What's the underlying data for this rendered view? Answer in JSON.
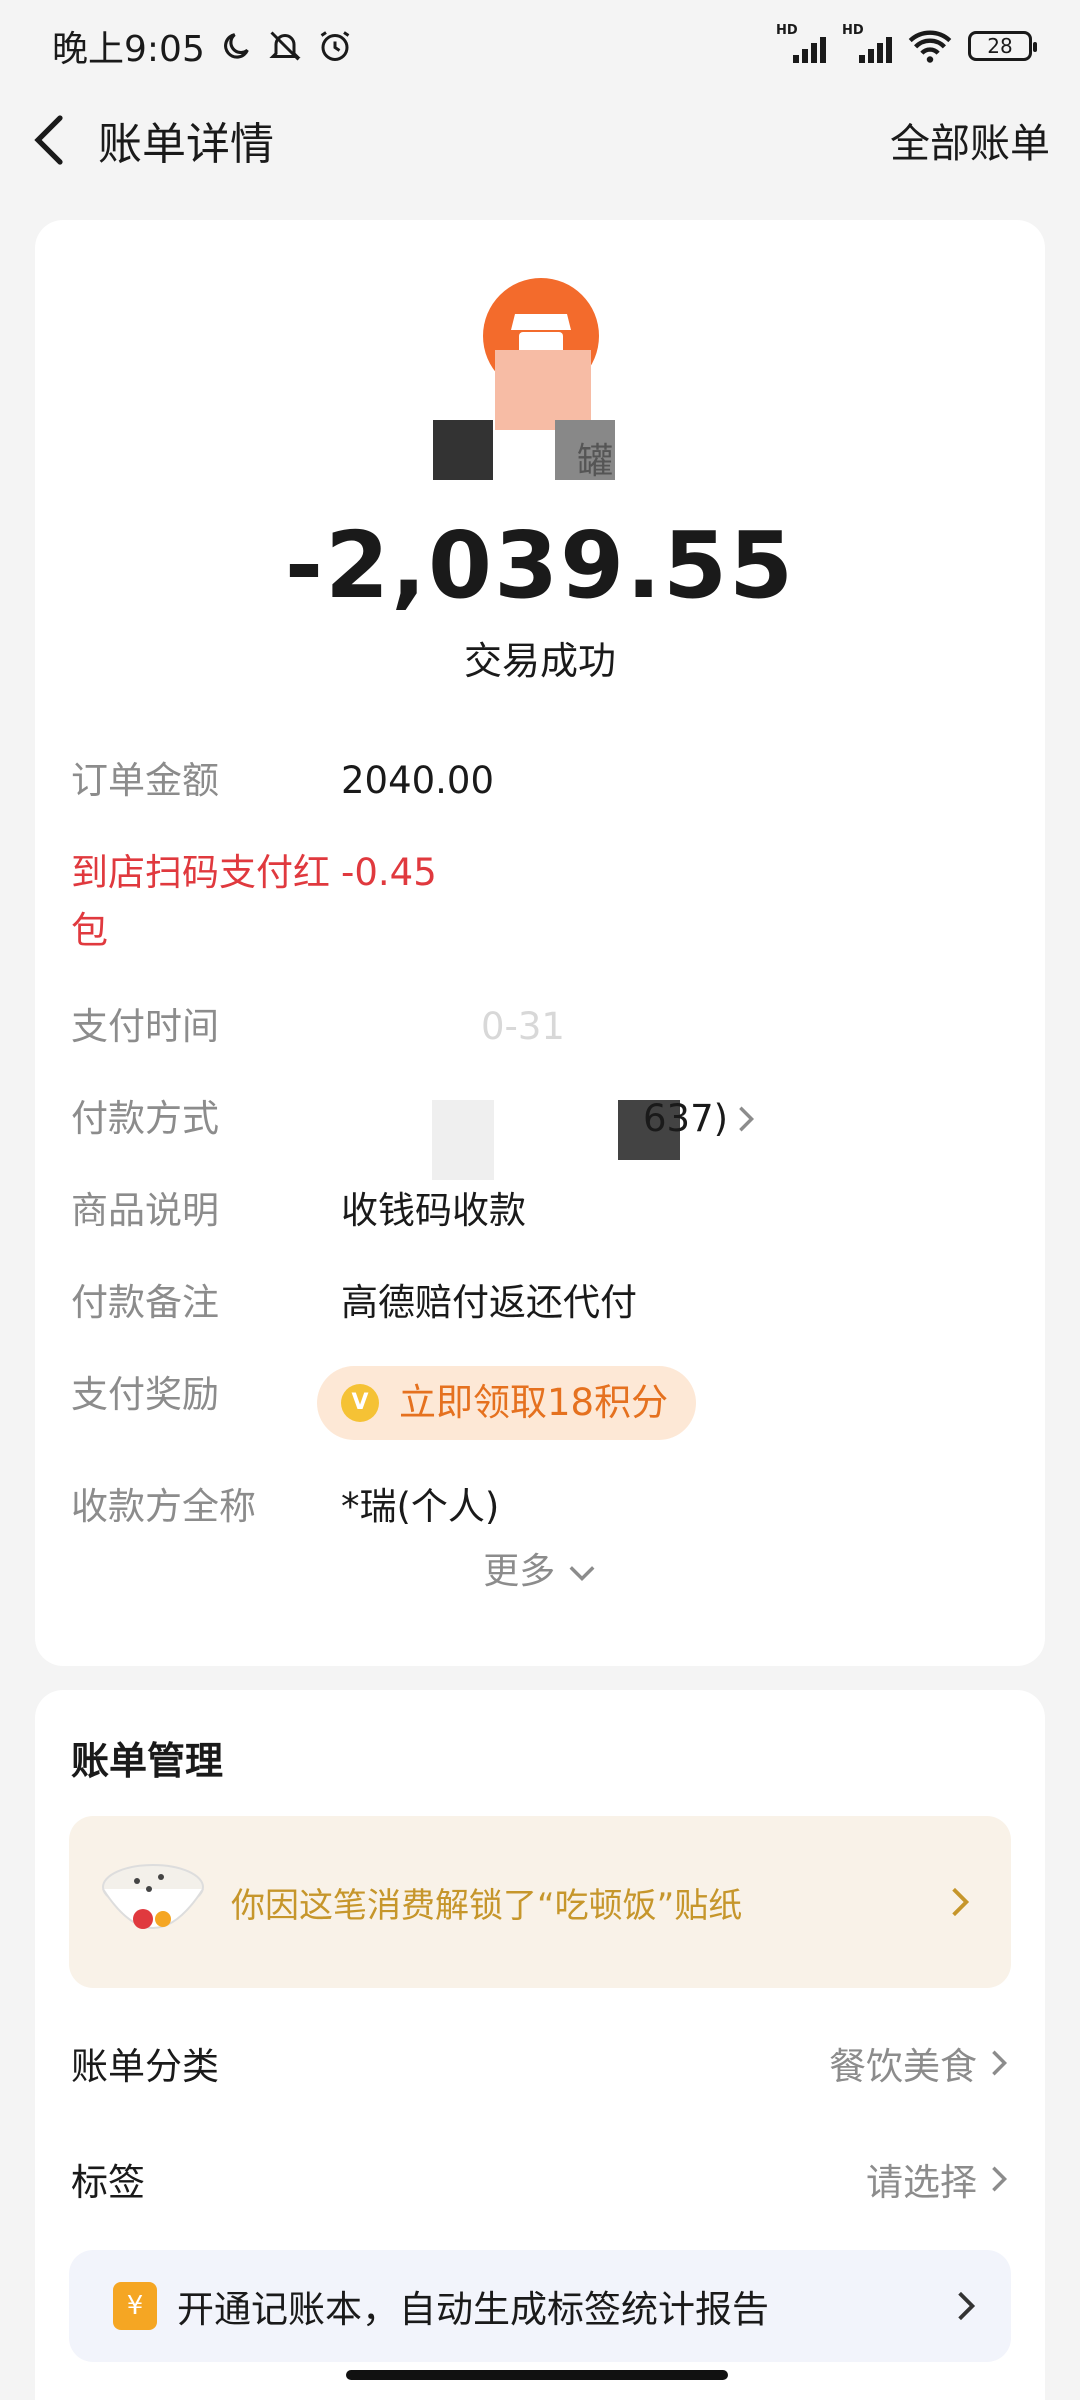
{
  "status_bar": {
    "time": "晚上9:05",
    "signal_hd_1": "HD",
    "signal_hd_2": "HD",
    "battery": "28"
  },
  "nav": {
    "title": "账单详情",
    "right_link": "全部账单"
  },
  "summary": {
    "merchant_name": "罐",
    "amount": "-2,039.55",
    "status": "交易成功"
  },
  "details": {
    "order_amount_label": "订单金额",
    "order_amount_value": "2040.00",
    "red_packet_label": "到店扫码支付红包",
    "red_packet_value": "-0.45",
    "pay_time_label": "支付时间",
    "pay_time_value": "0-31",
    "pay_method_label": "付款方式",
    "pay_method_value": "637)",
    "product_label": "商品说明",
    "product_value": "收钱码收款",
    "remark_label": "付款备注",
    "remark_value": "高德赔付返还代付",
    "reward_label": "支付奖励",
    "reward_value": "立即领取18积分",
    "payee_label": "收款方全称",
    "payee_value": "*瑞(个人)",
    "more": "更多"
  },
  "management": {
    "title": "账单管理",
    "sticker_text": "你因这笔消费解锁了“吃顿饭”贴纸",
    "category_label": "账单分类",
    "category_value": "餐饮美食",
    "tag_label": "标签",
    "tag_value": "请选择",
    "promo_text": "开通记账本，自动生成标签统计报告",
    "promo_icon": "¥"
  },
  "colors": {
    "accent_red": "#e0393e",
    "reward_orange": "#e5711f",
    "merchant_orange": "#f36b2c",
    "sticker_gold": "#c6962b"
  }
}
